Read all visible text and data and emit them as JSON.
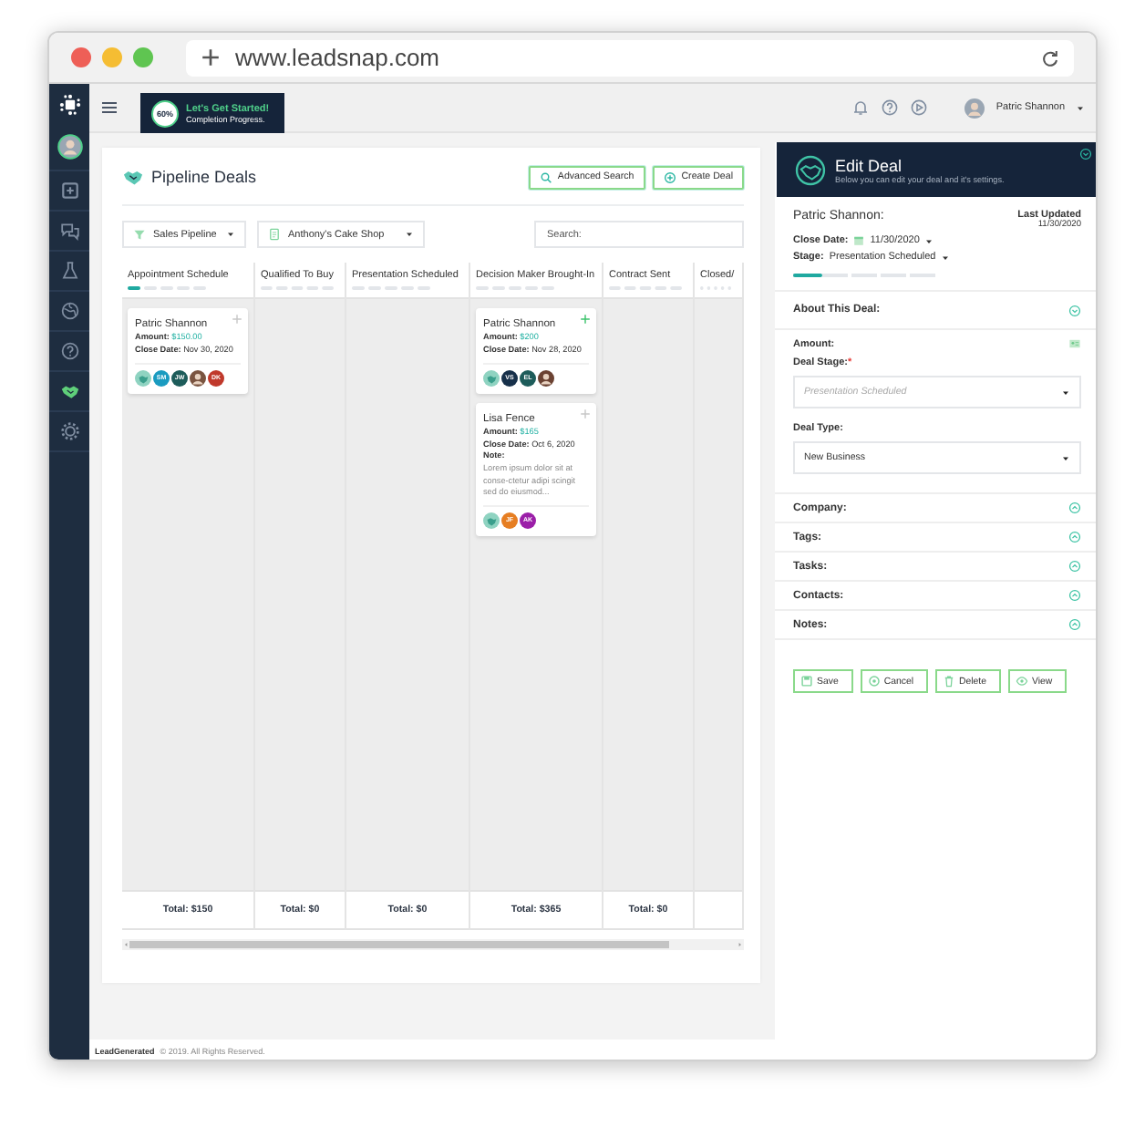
{
  "browser": {
    "url": "www.leadsnap.com"
  },
  "sidebar": {
    "items": [
      {
        "kind": "add",
        "selected": false
      },
      {
        "kind": "chat",
        "selected": false
      },
      {
        "kind": "flask",
        "selected": false
      },
      {
        "kind": "globe",
        "selected": false
      },
      {
        "kind": "help",
        "selected": false
      },
      {
        "kind": "handshake",
        "selected": true
      },
      {
        "kind": "gear",
        "selected": false
      }
    ]
  },
  "topbar": {
    "progress": {
      "percent": "60%",
      "title": "Let's Get Started!",
      "subtitle": "Completion Progress."
    },
    "user": "Patric Shannon"
  },
  "pipeline": {
    "title": "Pipeline Deals",
    "buttons": [
      {
        "kind": "search",
        "label": "Advanced Search"
      },
      {
        "kind": "create",
        "label": "Create Deal"
      }
    ],
    "filters": [
      {
        "kind": "pipeline",
        "label": "Sales Pipeline"
      },
      {
        "kind": "company",
        "label": "Anthony's Cake Shop"
      }
    ],
    "search": {
      "placeholder": "Search:"
    },
    "columns": [
      {
        "title": "Appointment Schedule",
        "selected": true,
        "total": "Total: $150",
        "deals": [
          {
            "name": "Patric Shannon",
            "amount_label": "Amount:",
            "amount": "$150.00",
            "date_label": "Close Date:",
            "date": "Nov 30, 2020",
            "add_active": false,
            "avatars": [
              {
                "kind": "logo",
                "color": "#8fd3c1"
              },
              {
                "kind": "initials",
                "initials": "SM",
                "color": "#1a9bc0"
              },
              {
                "kind": "initials",
                "initials": "JW",
                "color": "#1d5c5a"
              },
              {
                "kind": "photo",
                "color": "#7a5440"
              },
              {
                "kind": "initials",
                "initials": "DK",
                "color": "#c0392b"
              }
            ]
          }
        ]
      },
      {
        "title": "Qualified To Buy",
        "selected": false,
        "total": "Total: $0"
      },
      {
        "title": "Presentation Scheduled",
        "selected": false,
        "total": "Total: $0"
      },
      {
        "title": "Decision Maker Brought-In",
        "selected": false,
        "total": "Total: $365",
        "deals": [
          {
            "name": "Patric Shannon",
            "amount_label": "Amount:",
            "amount": "$200",
            "date_label": "Close Date:",
            "date": "Nov 28, 2020",
            "add_active": true,
            "avatars": [
              {
                "kind": "logo",
                "color": "#8fd3c1"
              },
              {
                "kind": "initials",
                "initials": "VS",
                "color": "#17304a"
              },
              {
                "kind": "initials",
                "initials": "EL",
                "color": "#1d5c5a"
              },
              {
                "kind": "photo",
                "color": "#6b4232"
              }
            ]
          },
          {
            "name": "Lisa Fence",
            "amount_label": "Amount:",
            "amount": "$165",
            "date_label": "Close Date:",
            "date": "Oct 6, 2020",
            "add_active": false,
            "note_label": "Note:",
            "note": "Lorem ipsum dolor sit at conse-ctetur adipi scingit sed do eiusmod...",
            "avatars": [
              {
                "kind": "logo",
                "color": "#8fd3c1"
              },
              {
                "kind": "initials",
                "initials": "JF",
                "color": "#e67e22"
              },
              {
                "kind": "initials",
                "initials": "AK",
                "color": "#9b1fa8"
              }
            ]
          }
        ]
      },
      {
        "title": "Contract Sent",
        "selected": false,
        "total": "Total: $0"
      },
      {
        "title": "Closed/",
        "selected": false
      }
    ]
  },
  "edit_deal": {
    "title": "Edit Deal",
    "subtitle": "Below you can edit your deal and it's settings.",
    "contact": "Patric Shannon:",
    "updated_label": "Last Updated",
    "updated": "11/30/2020",
    "close_label": "Close Date:",
    "close_date": "11/30/2020",
    "stage_label": "Stage:",
    "stage": "Presentation Scheduled",
    "progress": {
      "level": 0.2
    },
    "about": {
      "title": "About This Deal:",
      "expanded": true,
      "amount_label": "Amount:",
      "fields": [
        {
          "label": "Deal Stage:",
          "required_mark": "*",
          "placeholder": "Presentation Scheduled"
        },
        {
          "label": "Deal Type:",
          "value": "New Business"
        }
      ]
    },
    "sections": [
      {
        "title": "Company:",
        "expanded": false
      },
      {
        "title": "Tags:",
        "expanded": false
      },
      {
        "title": "Tasks:",
        "expanded": false
      },
      {
        "title": "Contacts:",
        "expanded": false
      },
      {
        "title": "Notes:",
        "expanded": false
      }
    ],
    "buttons": [
      {
        "kind": "save",
        "label": "Save"
      },
      {
        "kind": "cancel",
        "label": "Cancel"
      },
      {
        "kind": "delete",
        "label": "Delete"
      },
      {
        "kind": "view",
        "label": "View"
      }
    ]
  },
  "footer": {
    "brand": "LeadGenerated",
    "text": "© 2019. All Rights Reserved."
  }
}
